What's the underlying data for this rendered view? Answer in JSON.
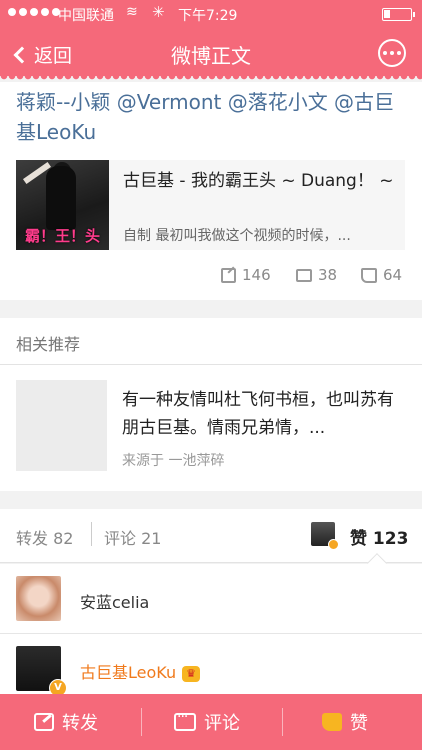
{
  "status_bar": {
    "carrier": "中国联通",
    "time": "下午7:29"
  },
  "nav": {
    "back_label": "返回",
    "title": "微博正文"
  },
  "post": {
    "mentions_text": "蒋颖--小颖 @Vermont @落花小文 @古巨基LeoKu",
    "video_card": {
      "thumb_caption": "霸！王！头",
      "title": "古巨基 - 我的霸王头 ~ Duang！ ~",
      "description": "自制 最初叫我做这个视频的时候，..."
    },
    "stats": {
      "reposts": "146",
      "comments": "38",
      "likes": "64"
    }
  },
  "related": {
    "heading": "相关推荐",
    "item": {
      "text": "有一种友情叫杜飞何书桓，也叫苏有朋古巨基。情雨兄弟情，...",
      "source": "来源于 一池萍碎"
    }
  },
  "tabs": {
    "repost": "转发 82",
    "comment": "评论 21",
    "like_label": "赞",
    "like_count": "123"
  },
  "likes_list": [
    {
      "name": "安蓝celia"
    },
    {
      "name": "古巨基LeoKu",
      "name_color": "#f07a1c"
    }
  ],
  "toolbar": {
    "repost": "转发",
    "comment": "评论",
    "like": "赞"
  },
  "colors": {
    "brand": "#f5697a",
    "link": "#4a6f98",
    "vip_name": "#f07a1c"
  }
}
